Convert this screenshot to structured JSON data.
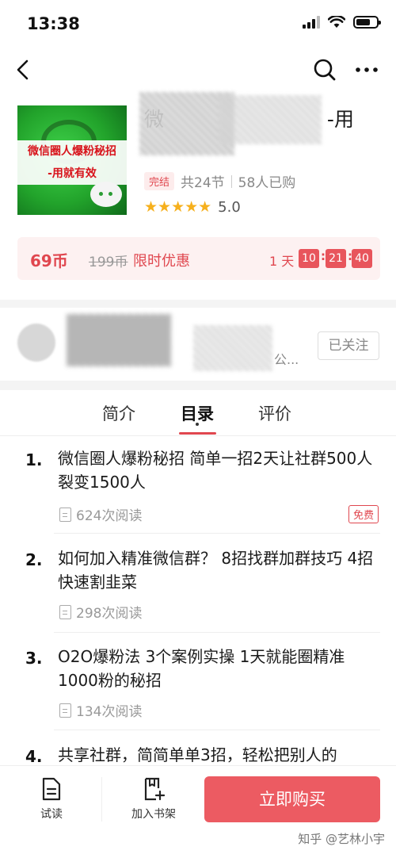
{
  "status_bar": {
    "time": "13:38"
  },
  "book": {
    "cover_text_line1": "微信圈人爆粉秘招",
    "cover_text_line2": "-用就有效",
    "title_visible_start": "微",
    "title_visible_end": "-用",
    "status_tag": "完结",
    "sections": "共24节",
    "purchases": "58人已购",
    "stars": "★★★★★",
    "rating": "5.0"
  },
  "promo": {
    "price": "69币",
    "original_price": "199币",
    "label": "限时优惠",
    "countdown_days": "1 天",
    "countdown_hours": "10",
    "countdown_minutes": "21",
    "countdown_seconds": "40"
  },
  "author": {
    "name_tail": "公...",
    "follow_label": "已关注"
  },
  "tabs": [
    {
      "label": "简介"
    },
    {
      "label": "目录",
      "active": true
    },
    {
      "label": "评价"
    }
  ],
  "chapters": [
    {
      "num": "1.",
      "title": "微信圈人爆粉秘招 简单一招2天让社群500人裂变1500人",
      "reads": "624次阅读",
      "badge": "免费"
    },
    {
      "num": "2.",
      "title": "如何加入精准微信群？ 8招找群加群技巧 4招快速割韭菜",
      "reads": "298次阅读"
    },
    {
      "num": "3.",
      "title": "O2O爆粉法 3个案例实操 1天就能圈精准1000粉的秘招",
      "reads": "134次阅读"
    },
    {
      "num": "4.",
      "title": "共享社群，简简单单3招，轻松把别人的"
    }
  ],
  "bottom_bar": {
    "trial_label": "试读",
    "add_shelf_label": "加入书架",
    "buy_label": "立即购买",
    "watermark": "知乎 @艺林小宇"
  },
  "colors": {
    "accent": "#e0474f",
    "buy_button": "#ec5b62",
    "star": "#f6b01d"
  }
}
